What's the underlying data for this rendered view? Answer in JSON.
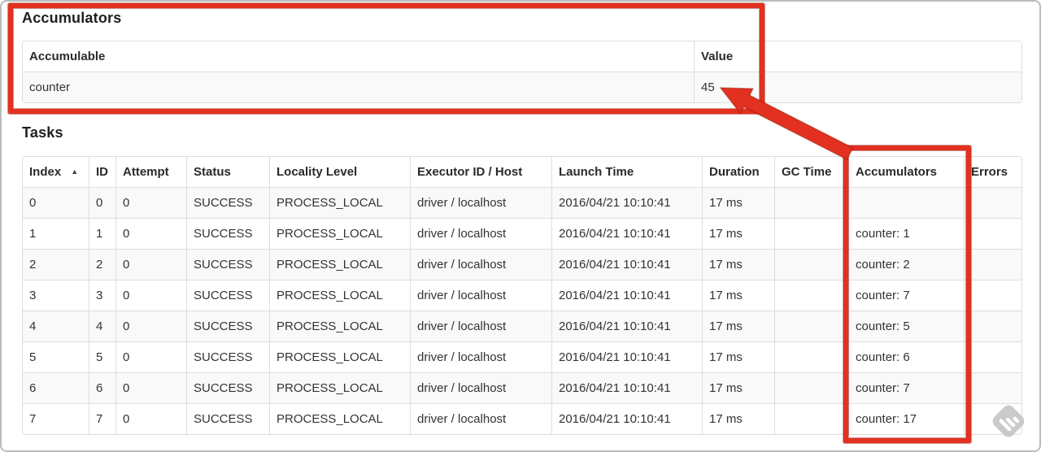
{
  "accumulators_section": {
    "title": "Accumulators",
    "table": {
      "headers": [
        "Accumulable",
        "Value"
      ],
      "rows": [
        [
          "counter",
          "45"
        ]
      ]
    }
  },
  "tasks_section": {
    "title": "Tasks",
    "table": {
      "sort_icon": "▲",
      "headers": [
        "Index",
        "ID",
        "Attempt",
        "Status",
        "Locality Level",
        "Executor ID / Host",
        "Launch Time",
        "Duration",
        "GC Time",
        "Accumulators",
        "Errors"
      ],
      "rows": [
        [
          "0",
          "0",
          "0",
          "SUCCESS",
          "PROCESS_LOCAL",
          "driver / localhost",
          "2016/04/21 10:10:41",
          "17 ms",
          "",
          "",
          ""
        ],
        [
          "1",
          "1",
          "0",
          "SUCCESS",
          "PROCESS_LOCAL",
          "driver / localhost",
          "2016/04/21 10:10:41",
          "17 ms",
          "",
          "counter: 1",
          ""
        ],
        [
          "2",
          "2",
          "0",
          "SUCCESS",
          "PROCESS_LOCAL",
          "driver / localhost",
          "2016/04/21 10:10:41",
          "17 ms",
          "",
          "counter: 2",
          ""
        ],
        [
          "3",
          "3",
          "0",
          "SUCCESS",
          "PROCESS_LOCAL",
          "driver / localhost",
          "2016/04/21 10:10:41",
          "17 ms",
          "",
          "counter: 7",
          ""
        ],
        [
          "4",
          "4",
          "0",
          "SUCCESS",
          "PROCESS_LOCAL",
          "driver / localhost",
          "2016/04/21 10:10:41",
          "17 ms",
          "",
          "counter: 5",
          ""
        ],
        [
          "5",
          "5",
          "0",
          "SUCCESS",
          "PROCESS_LOCAL",
          "driver / localhost",
          "2016/04/21 10:10:41",
          "17 ms",
          "",
          "counter: 6",
          ""
        ],
        [
          "6",
          "6",
          "0",
          "SUCCESS",
          "PROCESS_LOCAL",
          "driver / localhost",
          "2016/04/21 10:10:41",
          "17 ms",
          "",
          "counter: 7",
          ""
        ],
        [
          "7",
          "7",
          "0",
          "SUCCESS",
          "PROCESS_LOCAL",
          "driver / localhost",
          "2016/04/21 10:10:41",
          "17 ms",
          "",
          "counter: 17",
          ""
        ]
      ]
    }
  },
  "annotations": {
    "highlight_color": "#e23120",
    "outline_color": "#9c150a"
  }
}
